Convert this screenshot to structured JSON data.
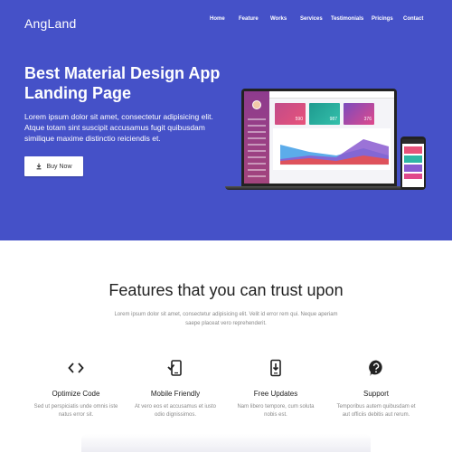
{
  "brand": "AngLand",
  "nav": [
    "Home",
    "Feature",
    "Works",
    "Services",
    "Testimonials",
    "Pricings",
    "Contact"
  ],
  "hero": {
    "headline": "Best Material Design App Landing Page",
    "subtext": "Lorem ipsum dolor sit amet, consectetur adipisicing elit. Atque totam sint suscipit accusamus fugit quibusdam similique maxime distinctio reiciendis et.",
    "buy_label": "Buy Now"
  },
  "mockup": {
    "cards": [
      {
        "value": "590",
        "color": "#e84f7a"
      },
      {
        "value": "987",
        "color": "#2fb6a6"
      },
      {
        "value": "376",
        "color": "#e0498b"
      }
    ]
  },
  "features": {
    "title": "Features that you can trust upon",
    "description": "Lorem ipsum dolor sit amet, consectetur adipisicing elit. Velit id error rem qui. Neque aperiam saepe placeat vero reprehenderit.",
    "items": [
      {
        "icon": "code-icon",
        "title": "Optimize Code",
        "text": "Sed ut perspiciatis unde omnis iste natus error sit."
      },
      {
        "icon": "mobile-check-icon",
        "title": "Mobile Friendly",
        "text": "At vero eos et accusamus et iusto odio dignissimos."
      },
      {
        "icon": "phone-download-icon",
        "title": "Free Updates",
        "text": "Nam libero tempore, cum soluta nobis est."
      },
      {
        "icon": "help-bubble-icon",
        "title": "Support",
        "text": "Temporibus autem quibusdam et aut officiis debitis aut rerum."
      }
    ]
  },
  "colors": {
    "hero_bg": "#4551c8",
    "white": "#ffffff"
  }
}
